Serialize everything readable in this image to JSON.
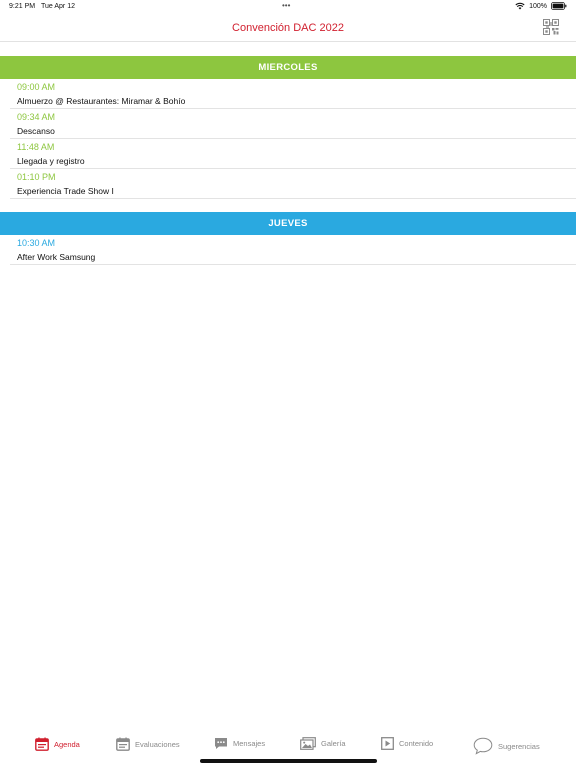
{
  "status": {
    "time": "9:21 PM",
    "date": "Tue Apr 12",
    "dots": "•••",
    "battery": "100%"
  },
  "nav": {
    "title": "Convención DAC 2022",
    "qr_icon": "qr-code-icon"
  },
  "colors": {
    "brand_red": "#d1202f",
    "green": "#8dc63f",
    "blue": "#2aa9e0",
    "tab_gray": "#8a8a8a"
  },
  "sections": [
    {
      "label": "MIERCOLES",
      "items": [
        {
          "time": "09:00 AM",
          "title": "Almuerzo @ Restaurantes: Miramar & Bohío"
        },
        {
          "time": "09:34 AM",
          "title": "Descanso"
        },
        {
          "time": "11:48 AM",
          "title": "Llegada y registro"
        },
        {
          "time": "01:10 PM",
          "title": "Experiencia Trade Show I"
        }
      ]
    },
    {
      "label": "JUEVES",
      "items": [
        {
          "time": "10:30 AM",
          "title": "After Work Samsung"
        }
      ]
    }
  ],
  "tabs": [
    {
      "label": "Agenda",
      "icon": "calendar-list-icon",
      "active": true
    },
    {
      "label": "Evaluaciones",
      "icon": "clipboard-icon",
      "active": false
    },
    {
      "label": "Mensajes",
      "icon": "chat-bubble-icon",
      "active": false
    },
    {
      "label": "Galería",
      "icon": "gallery-icon",
      "active": false
    },
    {
      "label": "Contenido",
      "icon": "play-square-icon",
      "active": false
    },
    {
      "label": "Sugerencias",
      "icon": "speech-bubble-icon",
      "active": false
    }
  ]
}
